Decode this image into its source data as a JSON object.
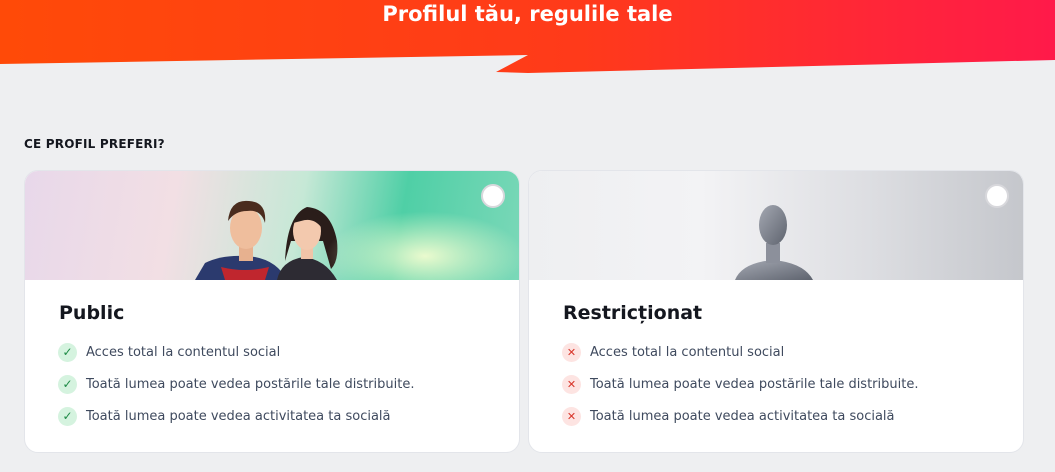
{
  "header": {
    "title": "Profilul tău, regulile tale"
  },
  "section": {
    "label": "CE PROFIL PREFERI?"
  },
  "cards": [
    {
      "id": "public",
      "title": "Public",
      "selected": false,
      "features": [
        {
          "icon": "check-icon",
          "text": "Acces total la contentul social"
        },
        {
          "icon": "check-icon",
          "text": "Toată lumea poate vedea postările tale distribuite."
        },
        {
          "icon": "check-icon",
          "text": "Toată lumea poate vedea activitatea ta socială"
        }
      ]
    },
    {
      "id": "restricted",
      "title": "Restricționat",
      "selected": false,
      "features": [
        {
          "icon": "cross-icon",
          "text": "Acces total la contentul social"
        },
        {
          "icon": "cross-icon",
          "text": "Toată lumea poate vedea postările tale distribuite."
        },
        {
          "icon": "cross-icon",
          "text": "Toată lumea poate vedea activitatea ta socială"
        }
      ]
    }
  ],
  "colors": {
    "accent": "#ff3a1a",
    "check": "#1e8a46",
    "cross": "#d8352a"
  }
}
